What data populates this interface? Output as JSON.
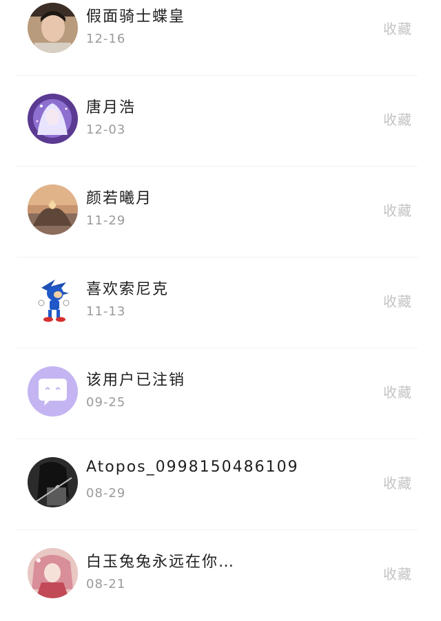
{
  "follow_list": {
    "items": [
      {
        "name": "假面骑士蝶皇",
        "date": "12-16",
        "action": "收藏",
        "avatar_icon": "person-photo-icon"
      },
      {
        "name": "唐月浩",
        "date": "12-03",
        "action": "收藏",
        "avatar_icon": "anime-girl-icon"
      },
      {
        "name": "颜若曦月",
        "date": "11-29",
        "action": "收藏",
        "avatar_icon": "heart-hands-sunset-icon"
      },
      {
        "name": "喜欢索尼克",
        "date": "11-13",
        "action": "收藏",
        "avatar_icon": "sonic-character-icon"
      },
      {
        "name": "该用户已注销",
        "date": "09-25",
        "action": "收藏",
        "avatar_icon": "deactivated-chat-bubble-icon"
      },
      {
        "name": "Atopos_0998150486109",
        "date": "08-29",
        "action": "收藏",
        "avatar_icon": "dark-character-icon"
      },
      {
        "name": "白玉兔兔永远在你…",
        "date": "08-21",
        "action": "收藏",
        "avatar_icon": "anime-character-icon"
      }
    ]
  }
}
